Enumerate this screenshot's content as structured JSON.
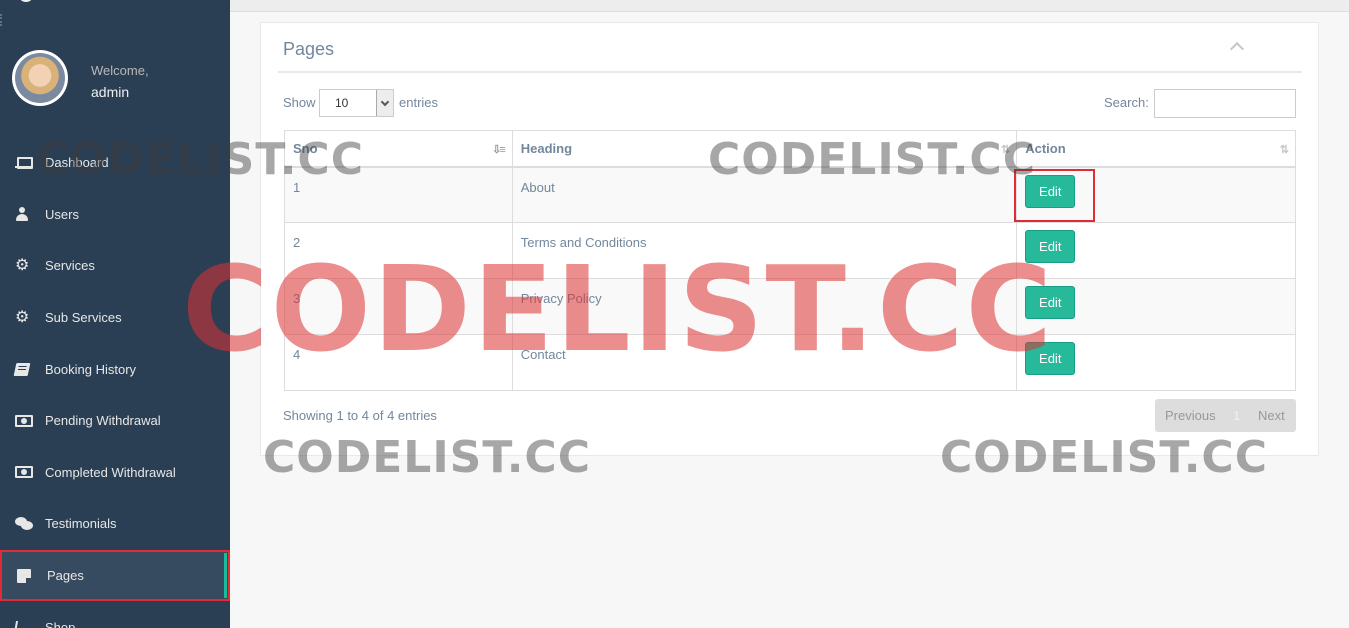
{
  "sidebar": {
    "welcome": "Welcome,",
    "username": "admin",
    "items": [
      {
        "label": "Dashboard",
        "icon": "laptop-icon"
      },
      {
        "label": "Users",
        "icon": "user-icon"
      },
      {
        "label": "Services",
        "icon": "gear-icon"
      },
      {
        "label": "Sub Services",
        "icon": "gear-icon"
      },
      {
        "label": "Booking History",
        "icon": "book-icon"
      },
      {
        "label": "Pending Withdrawal",
        "icon": "money-icon"
      },
      {
        "label": "Completed Withdrawal",
        "icon": "money-icon"
      },
      {
        "label": "Testimonials",
        "icon": "comments-icon"
      },
      {
        "label": "Pages",
        "icon": "sticky-note-icon",
        "active": true
      },
      {
        "label": "Shop",
        "icon": "cart-icon"
      }
    ]
  },
  "panel": {
    "title": "Pages",
    "length": {
      "prefix": "Show",
      "value": "10",
      "suffix": "entries"
    },
    "search": {
      "label": "Search:",
      "value": ""
    },
    "columns": [
      "Sno",
      "Heading",
      "Action"
    ],
    "rows": [
      {
        "sno": "1",
        "heading": "About",
        "action": "Edit"
      },
      {
        "sno": "2",
        "heading": "Terms and Conditions",
        "action": "Edit"
      },
      {
        "sno": "3",
        "heading": "Privacy Policy",
        "action": "Edit"
      },
      {
        "sno": "4",
        "heading": "Contact",
        "action": "Edit"
      }
    ],
    "info": "Showing 1 to 4 of 4 entries",
    "pagination": {
      "previous": "Previous",
      "page": "1",
      "next": "Next"
    }
  },
  "watermark": {
    "text": "CODELIST.CC"
  },
  "colors": {
    "sidebar": "#2A3F54",
    "accent": "#1ABB9C",
    "button": "#26B99A",
    "highlight": "#E02D35"
  }
}
